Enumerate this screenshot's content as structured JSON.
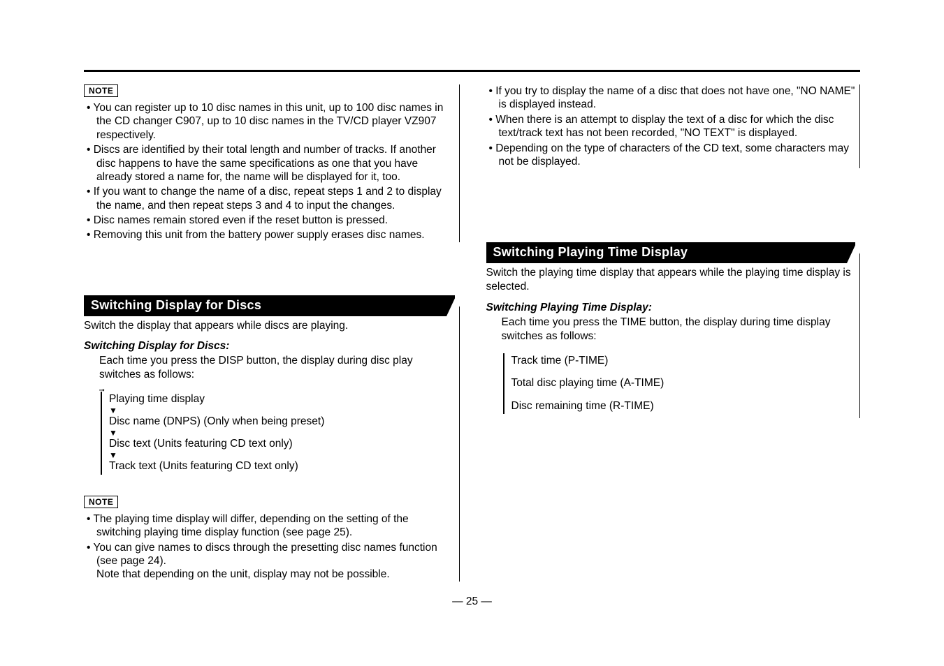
{
  "note_label": "NOTE",
  "left": {
    "note1": {
      "items": [
        "You can register up to 10 disc names in this unit, up to 100 disc names in the CD changer C907, up to 10 disc names in the TV/CD player VZ907 respectively.",
        "Discs are identified by their total length and number of tracks. If another disc happens to have the same specifications as one that you have already stored a name for, the name will be displayed for it, too.",
        "If you want to change the name of a disc, repeat steps 1 and 2 to display the name, and then repeat steps 3 and 4 to input the changes.",
        "Disc names remain stored even if the reset button is pressed.",
        "Removing this unit from the battery power supply erases disc names."
      ]
    },
    "section_title": "Switching Display for Discs",
    "section_lead": "Switch the display that appears while discs are playing.",
    "subhead": "Switching Display for Discs:",
    "subbody": "Each time you press the DISP button, the display during disc play switches as follows:",
    "cycle": [
      "Playing time display",
      "Disc name (DNPS) (Only when being preset)",
      "Disc text (Units featuring CD text only)",
      "Track text (Units featuring CD text only)"
    ],
    "note2": {
      "items": [
        "The playing time display will differ, depending on the setting of the switching playing time display function (see page 25).",
        "You can give names to discs through the presetting disc names function (see page 24)."
      ],
      "extra": "Note that depending on the unit, display may not be possible."
    }
  },
  "right": {
    "top_notes": [
      "If you try to display the name of a disc that does not have one, \"NO NAME\" is displayed instead.",
      "When there is an attempt to display the text of a disc for which the disc text/track text has not been recorded, \"NO TEXT\" is displayed.",
      "Depending on the type of characters of the CD text, some characters may not be displayed."
    ],
    "section_title": "Switching Playing Time Display",
    "section_lead": "Switch the playing time display that appears while the playing time display is selected.",
    "subhead": "Switching Playing Time Display:",
    "subbody": "Each time you press the TIME button, the display during time display switches as follows:",
    "cycle": [
      "Track time (P-TIME)",
      "Total disc playing time (A-TIME)",
      "Disc remaining time (R-TIME)"
    ]
  },
  "page_number": "— 25 —"
}
